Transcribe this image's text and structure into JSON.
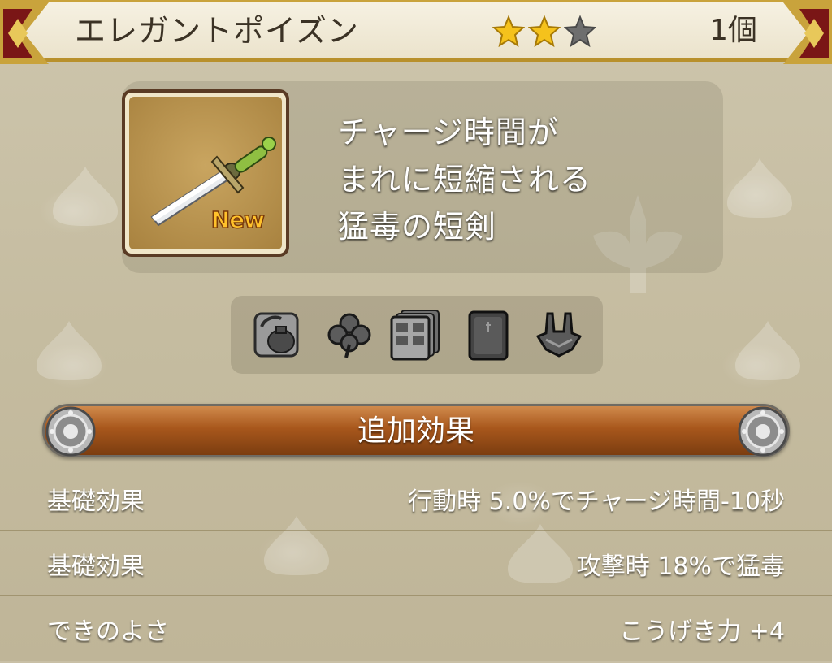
{
  "item": {
    "name": "エレガントポイズン",
    "rarity_stars": 3,
    "rarity_filled": 2,
    "count": "1個",
    "new_badge": "New"
  },
  "description": {
    "lines": [
      "チャージ時間が",
      "まれに短縮される",
      "猛毒の短剣"
    ]
  },
  "equip_icons": [
    "bag-refresh-icon",
    "clover-icon",
    "drawer-cards-icon",
    "book-icon",
    "armor-icon"
  ],
  "effects_header": "追加効果",
  "effects": [
    {
      "label": "基礎効果",
      "value": "行動時  5.0%でチャージ時間-10秒"
    },
    {
      "label": "基礎効果",
      "value": "攻撃時  18%で猛毒"
    },
    {
      "label": "できのよさ",
      "value": "こうげき力 +4"
    }
  ],
  "colors": {
    "star_filled": "#f5c21c",
    "star_empty": "#6e6e6e",
    "effect_bar": "#a8571c",
    "header_trim": "#c9a33c"
  }
}
